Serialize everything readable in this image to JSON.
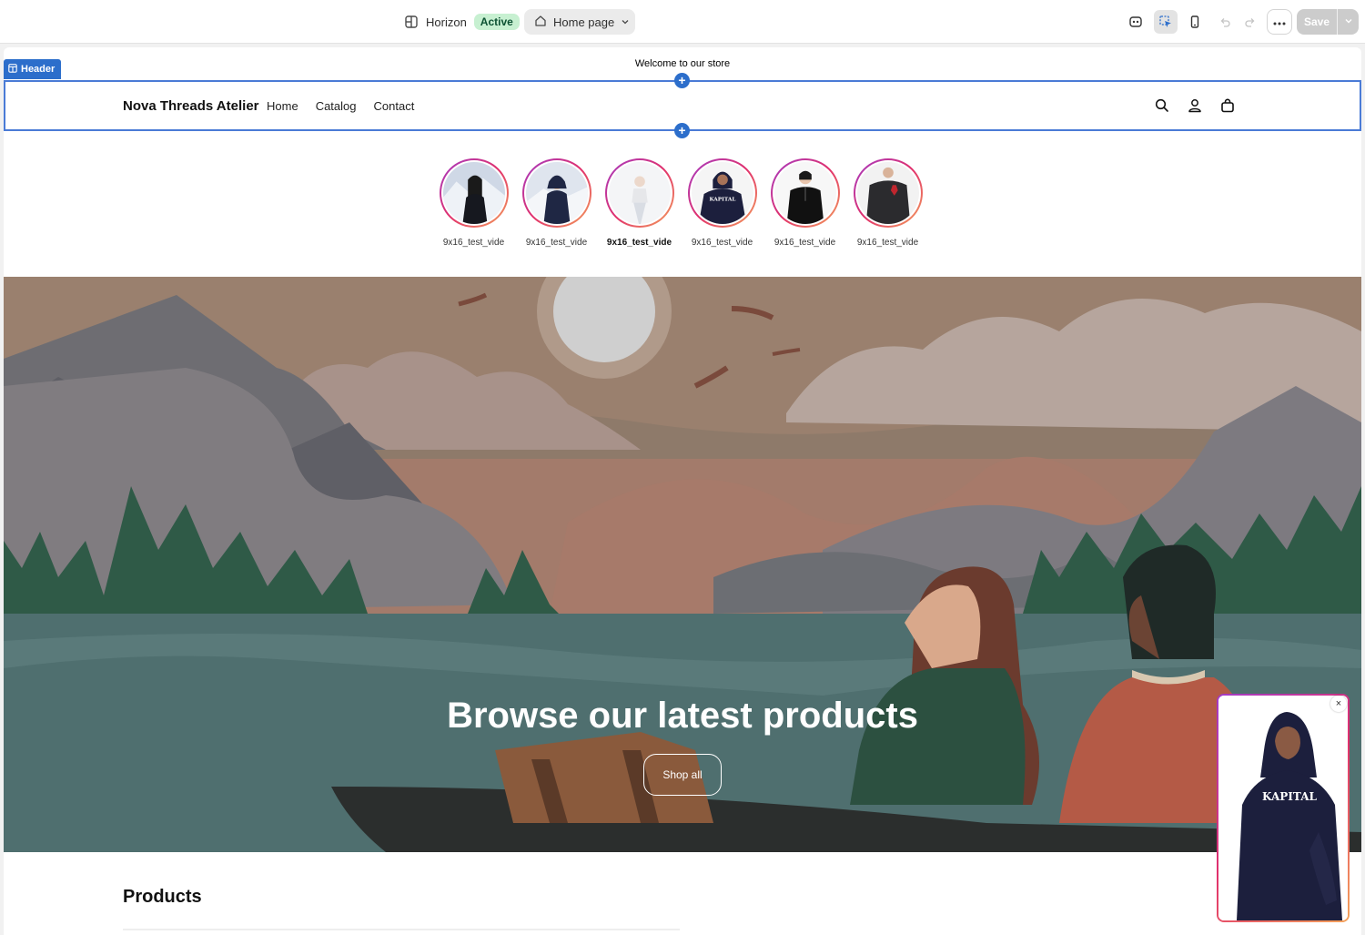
{
  "topbar": {
    "theme_name": "Horizon",
    "theme_status": "Active",
    "page_select": "Home page",
    "save_label": "Save",
    "colors": {
      "active_badge_bg": "#c7f0d1",
      "active_badge_text": "#0c5132",
      "save_disabled": "#cccccc",
      "accent": "#2c6ecb"
    }
  },
  "editor": {
    "section_tag": "Header"
  },
  "store": {
    "announcement": "Welcome to our store",
    "logo": "Nova Threads Atelier",
    "nav": [
      "Home",
      "Catalog",
      "Contact"
    ],
    "header_icons": [
      "search-icon",
      "account-icon",
      "cart-icon"
    ]
  },
  "stories": [
    {
      "label": "9x16_test_vide",
      "bold": false
    },
    {
      "label": "9x16_test_vide",
      "bold": false
    },
    {
      "label": "9x16_test_vide",
      "bold": true
    },
    {
      "label": "9x16_test_vide",
      "bold": false
    },
    {
      "label": "9x16_test_vide",
      "bold": false
    },
    {
      "label": "9x16_test_vide",
      "bold": false
    }
  ],
  "hero": {
    "title": "Browse our latest products",
    "button": "Shop all"
  },
  "products": {
    "title": "Products"
  },
  "float_video": {
    "close": "×",
    "shirt_text": "KAPITAL"
  }
}
